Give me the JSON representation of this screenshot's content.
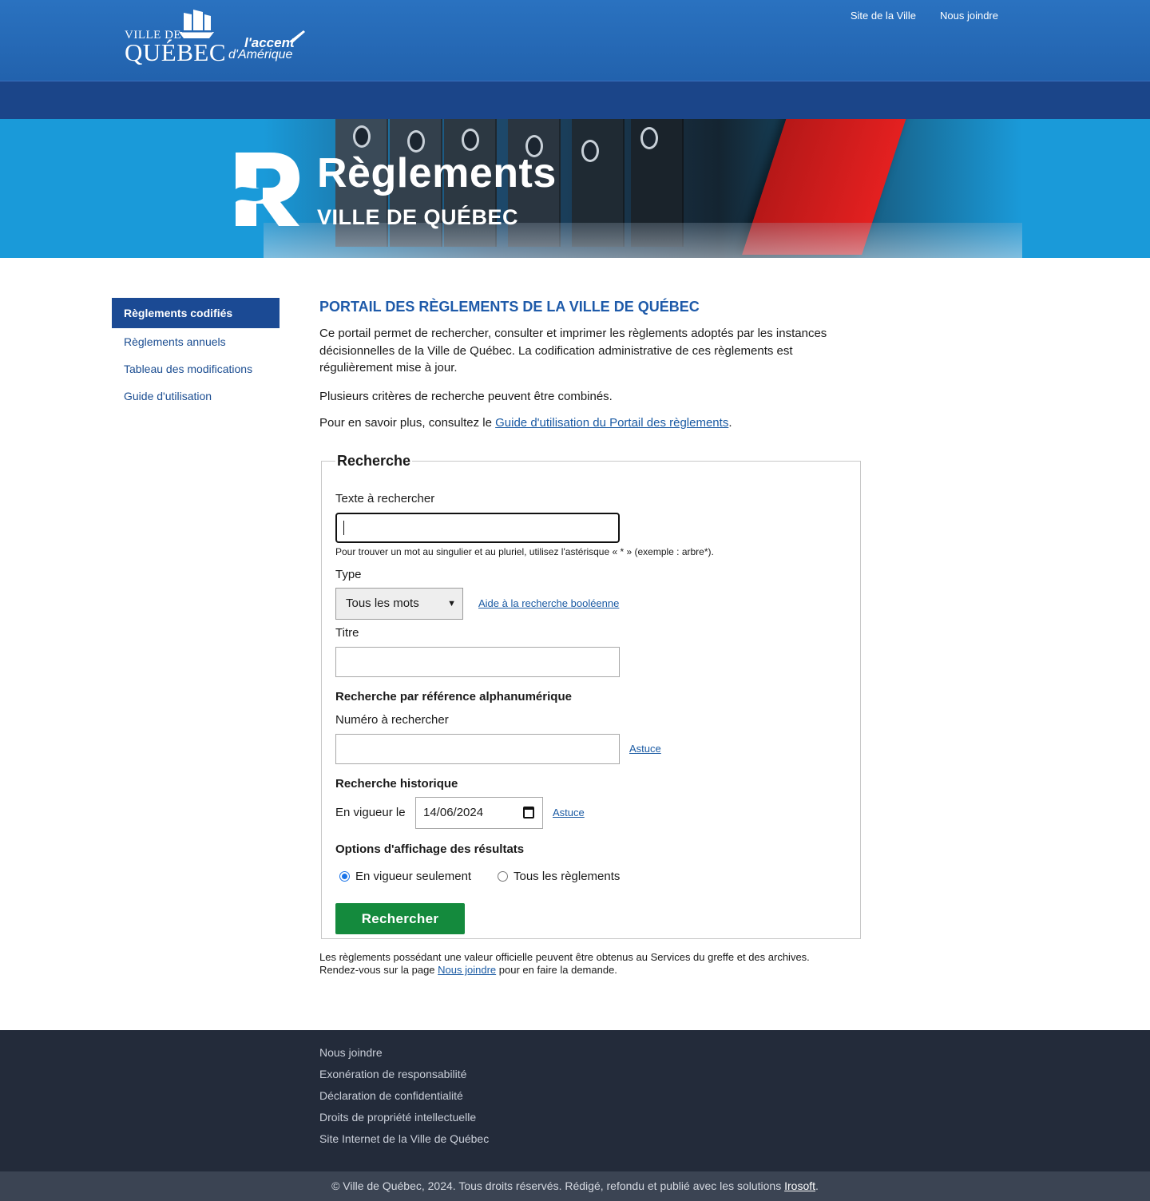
{
  "header": {
    "logo": {
      "line1": "VILLE DE",
      "line2": "QUÉBEC",
      "tagline1": "l'accent",
      "tagline2": "d'Amérique"
    },
    "links": [
      "Site de la Ville",
      "Nous joindre"
    ],
    "colors": {
      "topbar": "#2568b5",
      "navbar": "#1b4589"
    }
  },
  "banner": {
    "title": "Règlements",
    "subtitle": "VILLE DE QUÉBEC",
    "logo_icon": "r-logo-icon"
  },
  "sidebar": {
    "items": [
      {
        "label": "Règlements codifiés",
        "active": true
      },
      {
        "label": "Règlements annuels",
        "active": false
      },
      {
        "label": "Tableau des modifications",
        "active": false
      },
      {
        "label": "Guide d'utilisation",
        "active": false
      }
    ]
  },
  "main": {
    "title": "PORTAIL DES RÈGLEMENTS DE LA VILLE DE QUÉBEC",
    "intro": "Ce portail permet de rechercher, consulter et imprimer les règlements adoptés par les instances décisionnelles de la Ville de Québec. La codification administrative de ces règlements est régulièrement mise à jour.",
    "criteria": "Plusieurs critères de recherche peuvent être combinés.",
    "more_prefix": "Pour en savoir plus, consultez le ",
    "more_link": "Guide d'utilisation du Portail des règlements",
    "more_suffix": "."
  },
  "search": {
    "legend": "Recherche",
    "text_label": "Texte à rechercher",
    "text_value": "",
    "text_hint": "Pour trouver un mot au singulier et au pluriel, utilisez l'astérisque « * » (exemple : arbre*).",
    "type_label": "Type",
    "type_selected": "Tous les mots",
    "boolean_help": "Aide à la recherche booléenne",
    "title_label": "Titre",
    "title_value": "",
    "ref_heading": "Recherche par référence alphanumérique",
    "number_label": "Numéro à rechercher",
    "number_value": "",
    "tip1": "Astuce",
    "history_heading": "Recherche historique",
    "in_force_label": "En vigueur le",
    "date_value": "14/06/2024",
    "tip2": "Astuce",
    "options_heading": "Options d'affichage des résultats",
    "radio1": "En vigueur seulement",
    "radio2": "Tous les règlements",
    "radio_selected": "En vigueur seulement",
    "submit": "Rechercher",
    "submit_color": "#148a3d"
  },
  "note": {
    "line1": "Les règlements possédant une valeur officielle peuvent être obtenus au Services du greffe et des archives.",
    "line2_prefix": "Rendez-vous sur la page ",
    "line2_link": "Nous joindre",
    "line2_suffix": " pour en faire la demande."
  },
  "footer": {
    "links": [
      "Nous joindre",
      "Exonération de responsabilité",
      "Déclaration de confidentialité",
      "Droits de propriété intellectuelle",
      "Site Internet de la Ville de Québec"
    ],
    "copyright_prefix": "© Ville de Québec, 2024. Tous droits réservés. Rédigé, refondu et publié avec les solutions ",
    "copyright_link": "Irosoft",
    "copyright_suffix": "."
  }
}
